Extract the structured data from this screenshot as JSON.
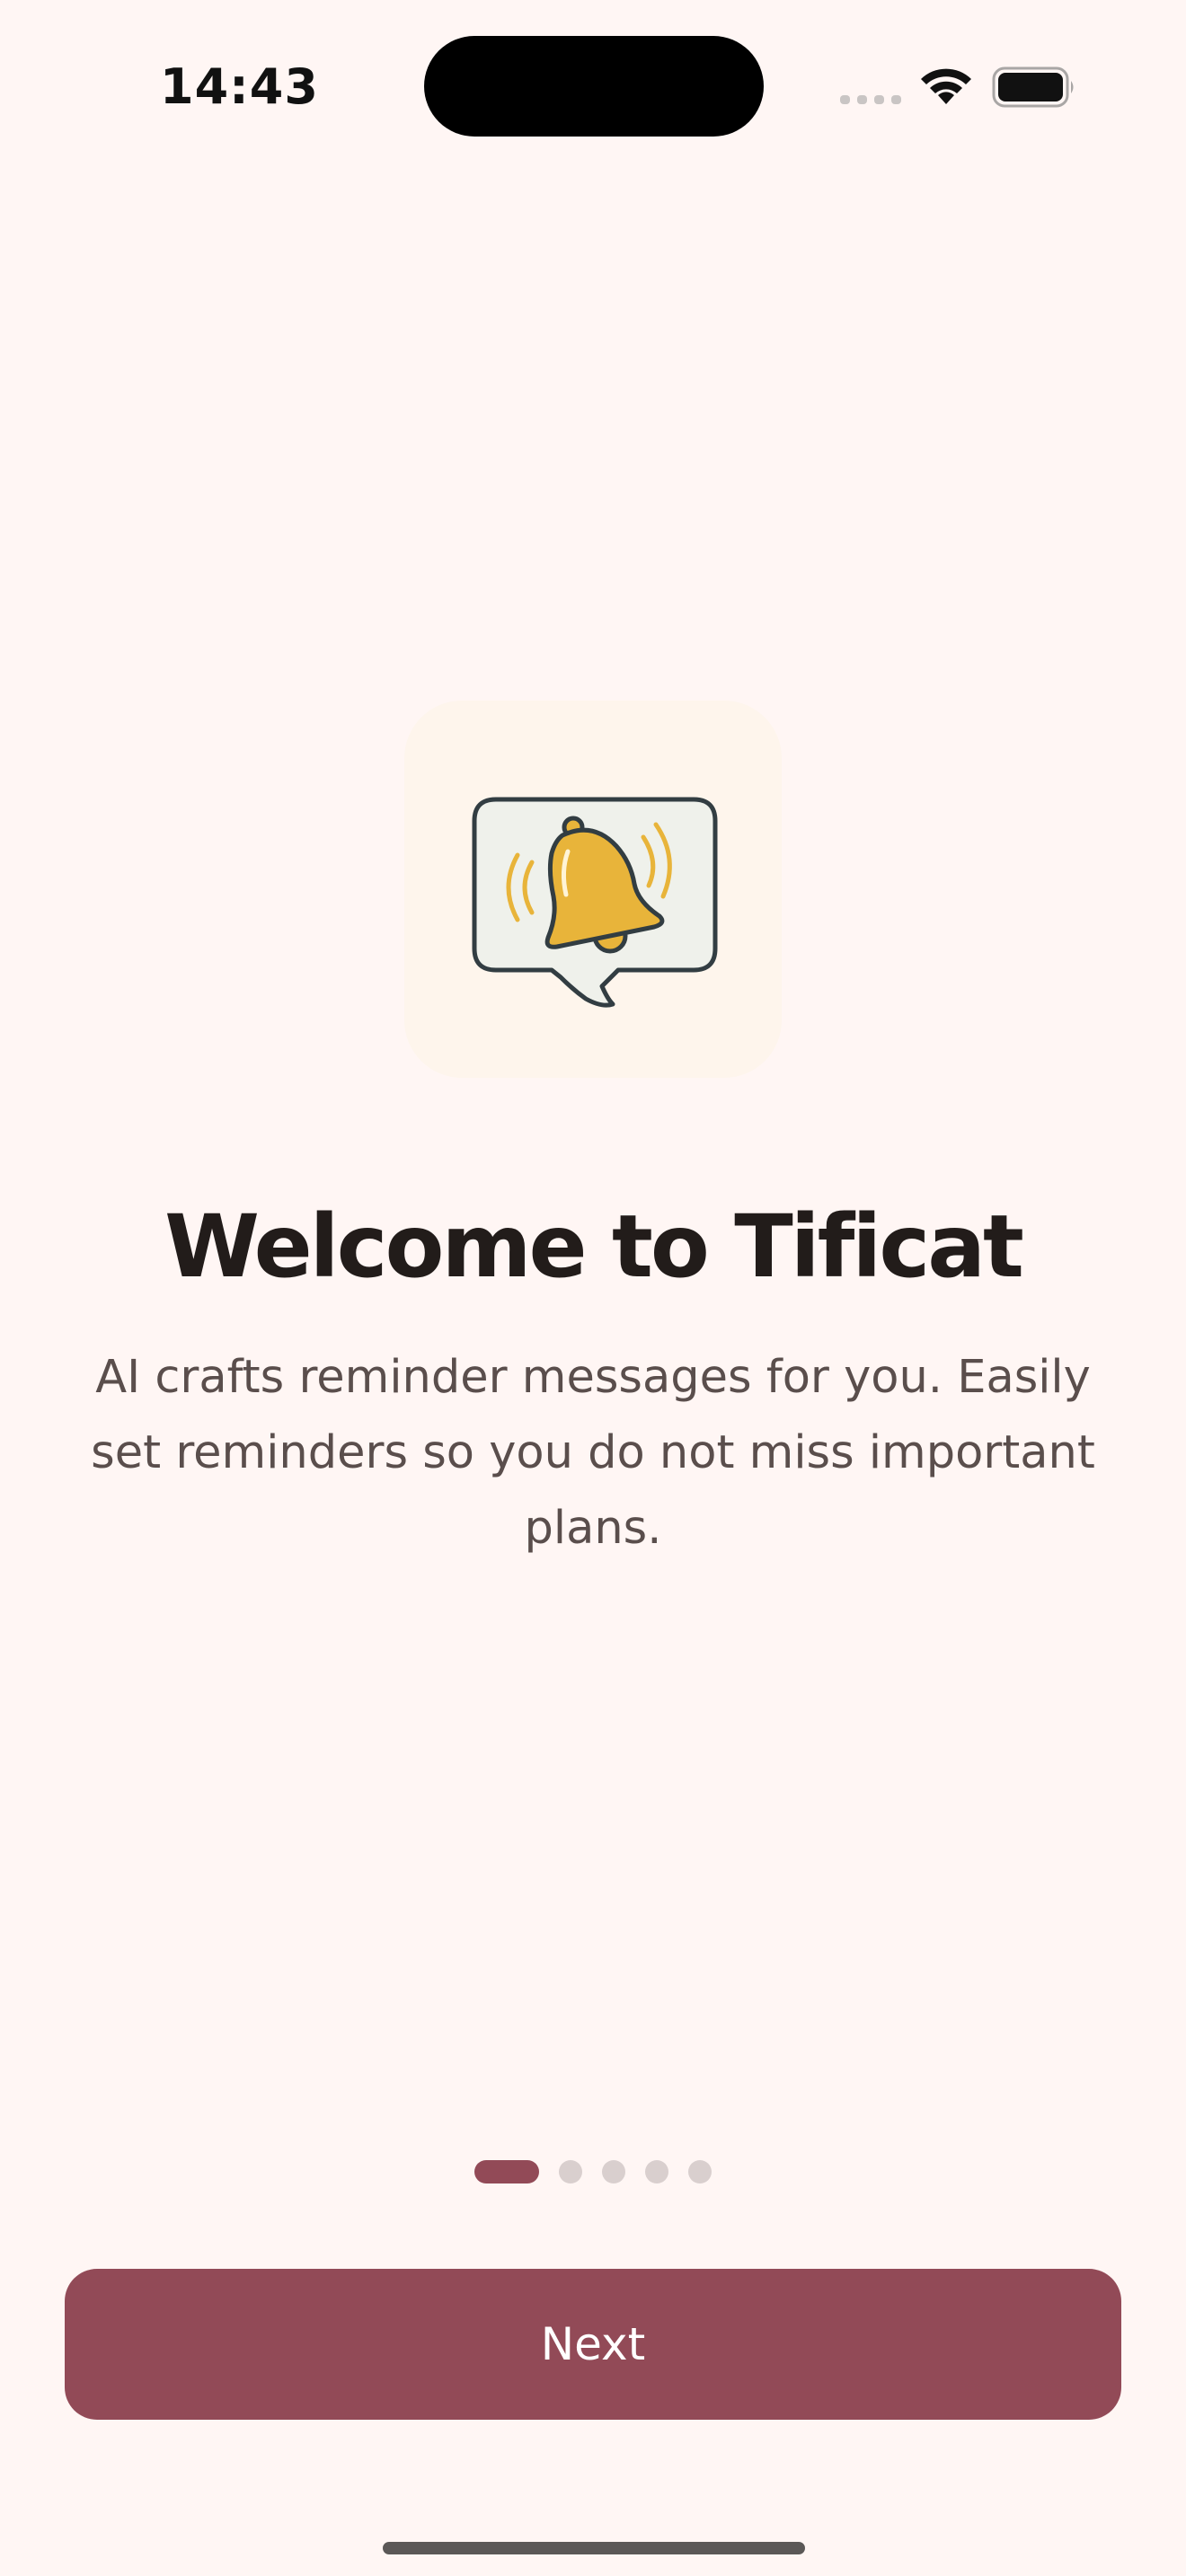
{
  "status_bar": {
    "time": "14:43",
    "icons": [
      "signal-icon",
      "wifi-icon",
      "battery-icon"
    ]
  },
  "onboarding": {
    "illustration_icon": "bell-in-speech-bubble-icon",
    "title": "Welcome to Tificat",
    "description": "AI crafts reminder messages for you. Easily set reminders so you do not miss important plans.",
    "pagination": {
      "total_pages": 5,
      "current_page": 1
    },
    "next_label": "Next"
  },
  "colors": {
    "background": "#FFF6F4",
    "accent": "#924A57",
    "icon_tile": "#FEF5EC",
    "bell": "#E8B43A",
    "inactive_dot": "#D9CFCE",
    "title_text": "#221C1A",
    "body_text": "#5A4E4C"
  }
}
